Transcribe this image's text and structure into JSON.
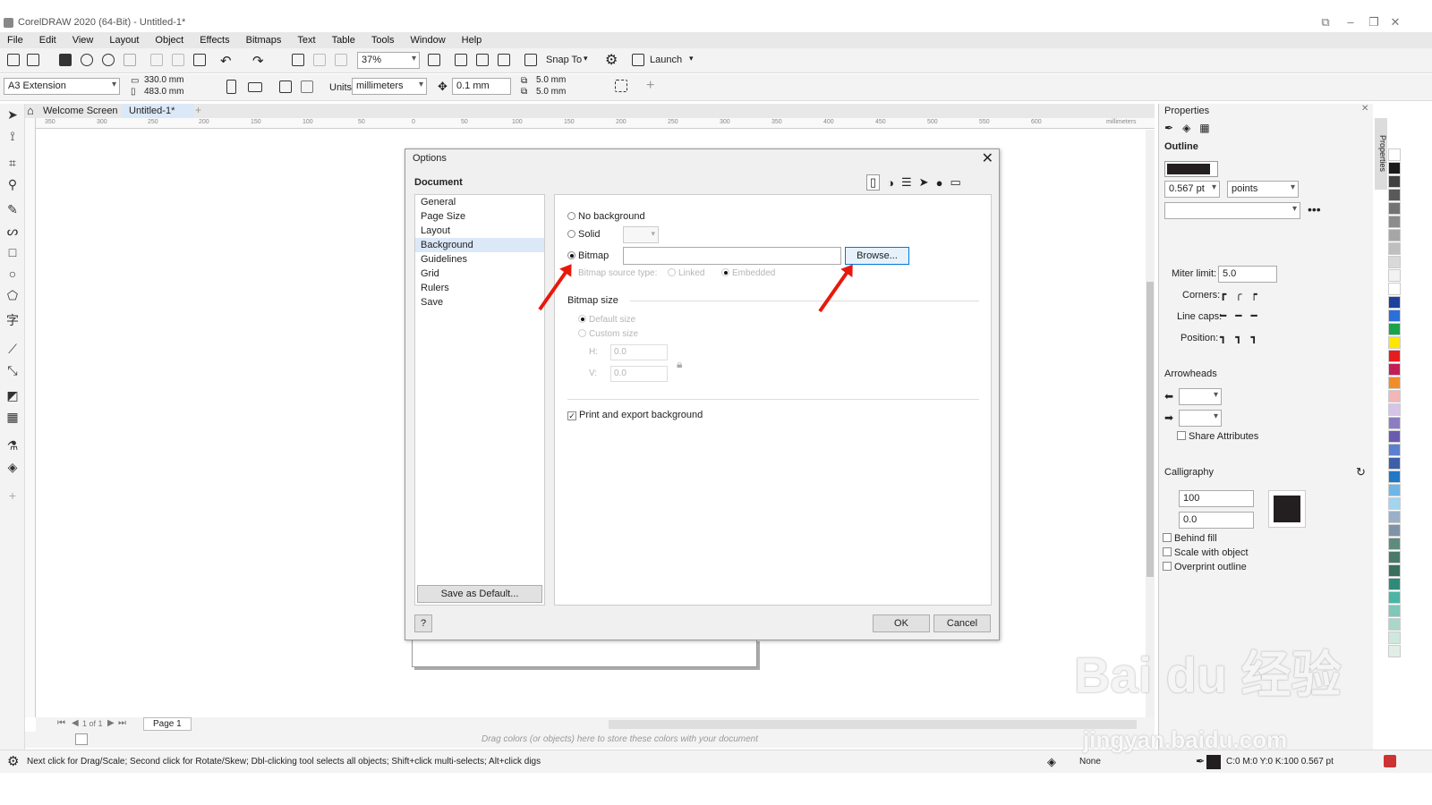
{
  "window": {
    "title": "CorelDRAW 2020 (64-Bit) - Untitled-1*"
  },
  "menu": [
    "File",
    "Edit",
    "View",
    "Layout",
    "Object",
    "Effects",
    "Bitmaps",
    "Text",
    "Table",
    "Tools",
    "Window",
    "Help"
  ],
  "toolbar": {
    "zoom": "37%",
    "snap_label": "Snap To",
    "launch_label": "Launch"
  },
  "propbar": {
    "page_size": "A3 Extension",
    "width": "330.0 mm",
    "height": "483.0 mm",
    "units_label": "Units:",
    "units": "millimeters",
    "nudge": "0.1 mm",
    "dup_x": "5.0 mm",
    "dup_y": "5.0 mm"
  },
  "tabs": {
    "welcome": "Welcome Screen",
    "doc": "Untitled-1*"
  },
  "ruler": {
    "ticks": [
      "350",
      "300",
      "250",
      "200",
      "150",
      "100",
      "50",
      "0",
      "50",
      "100",
      "150",
      "200",
      "250",
      "300",
      "350",
      "400",
      "450",
      "500",
      "550",
      "600"
    ],
    "unit": "millimeters"
  },
  "dialog": {
    "title": "Options",
    "section": "Document",
    "nav": [
      "General",
      "Page Size",
      "Layout",
      "Background",
      "Guidelines",
      "Grid",
      "Rulers",
      "Save"
    ],
    "selected_nav": "Background",
    "no_background": "No background",
    "solid": "Solid",
    "bitmap": "Bitmap",
    "browse": "Browse...",
    "bitmap_source_type": "Bitmap source type:",
    "linked": "Linked",
    "embedded": "Embedded",
    "bitmap_size": "Bitmap size",
    "default_size": "Default size",
    "custom_size": "Custom size",
    "h_label": "H:",
    "v_label": "V:",
    "h_value": "0.0",
    "v_value": "0.0",
    "print_export": "Print and export background",
    "save_default": "Save as Default...",
    "help": "?",
    "ok": "OK",
    "cancel": "Cancel"
  },
  "properties": {
    "title": "Properties",
    "outline": "Outline",
    "width": "0.567 pt",
    "width_units": "points",
    "miter_label": "Miter limit:",
    "miter_value": "5.0",
    "corners": "Corners:",
    "line_caps": "Line caps:",
    "position": "Position:",
    "arrowheads": "Arrowheads",
    "share": "Share Attributes",
    "calligraphy": "Calligraphy",
    "stretch": "100",
    "angle": "0.0",
    "behind_fill": "Behind fill",
    "scale": "Scale with object",
    "overprint": "Overprint outline",
    "side_tab": "Properties"
  },
  "pages": {
    "page_nav": "1 of 1",
    "page_tab": "Page 1"
  },
  "docpalette": {
    "hint": "Drag colors (or objects) here to store these colors with your document"
  },
  "status": {
    "hint": "Next click for Drag/Scale; Second click for Rotate/Skew; Dbl-clicking tool selects all objects; Shift+click multi-selects; Alt+click digs",
    "fill": "None",
    "outline": "C:0 M:0 Y:0 K:100  0.567 pt"
  },
  "watermark": {
    "logo": "Bai du 经验",
    "url": "jingyan.baidu.com"
  },
  "palette_colors": [
    "#ffffff",
    "#1a1a1a",
    "#404040",
    "#595959",
    "#737373",
    "#8c8c8c",
    "#a6a6a6",
    "#bfbfbf",
    "#d9d9d9",
    "#f2f2f2",
    "#ffffff",
    "#1d3f9e",
    "#2a6fdb",
    "#1aa34a",
    "#ffe600",
    "#e81d1d",
    "#c21e56",
    "#f28c28",
    "#f4b6b6",
    "#d6c4e8",
    "#8e7cc3",
    "#6b5bb0",
    "#5b7fd1",
    "#3d5ea8",
    "#1f78c8",
    "#6fb6e8",
    "#a3d4f0",
    "#9ab0c9",
    "#7f93a8",
    "#5e8c7c",
    "#4a7a6a",
    "#3a6f5e",
    "#2e8b7a",
    "#4ab5a4",
    "#7fc7b8",
    "#a9d8c8",
    "#cde8dc",
    "#e0eee6"
  ]
}
